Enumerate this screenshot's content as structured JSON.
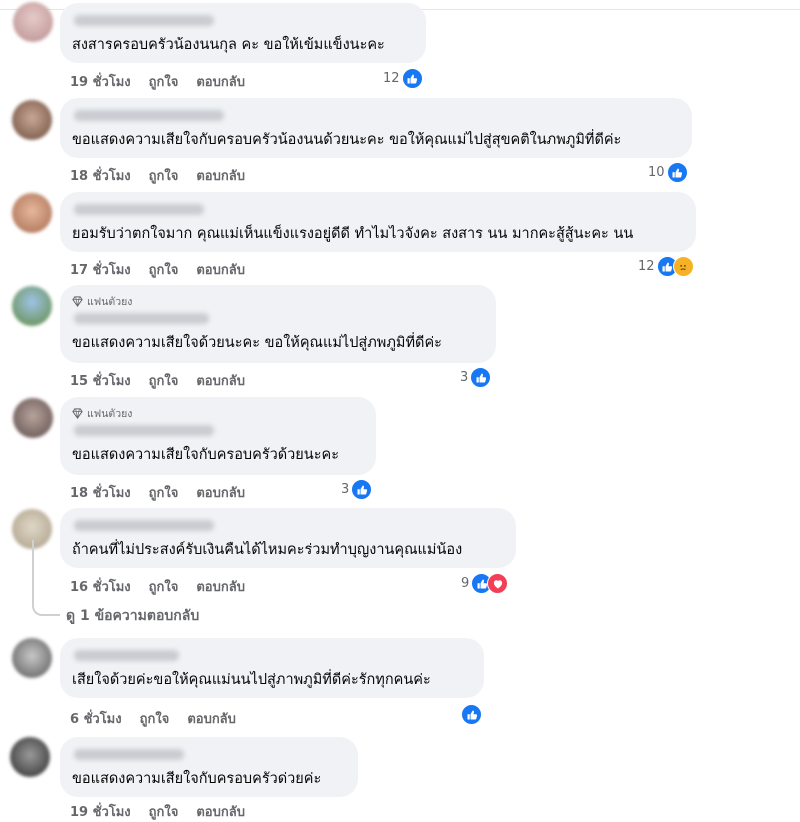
{
  "comments": [
    {
      "text": "สงสารครอบครัวน้องนนกุล คะ ขอให้เข้มแข็งนะคะ",
      "time": "19 ชั่วโมง",
      "like": "ถูกใจ",
      "reply": "ตอบกลับ",
      "count": "12",
      "badge": ""
    },
    {
      "text": "ขอแสดงความเสียใจกับครอบครัวน้องนนด้วยนะคะ ขอให้คุณแม่ไปสู่สุขคติในภพภูมิที่ดีค่ะ",
      "time": "18 ชั่วโมง",
      "like": "ถูกใจ",
      "reply": "ตอบกลับ",
      "count": "10",
      "badge": ""
    },
    {
      "text": "ยอมรับว่าตกใจมาก คุณแม่เห็นแข็งแรงอยู่ดีดี ทำไมไวจังคะ สงสาร นน มากคะสู้สู้นะคะ นน",
      "time": "17 ชั่วโมง",
      "like": "ถูกใจ",
      "reply": "ตอบกลับ",
      "count": "12",
      "badge": ""
    },
    {
      "text": "ขอแสดงความเสียใจด้วยนะคะ ขอให้คุณแม่ไปสู่ภพภูมิที่ดีค่ะ",
      "time": "15 ชั่วโมง",
      "like": "ถูกใจ",
      "reply": "ตอบกลับ",
      "count": "3",
      "badge": "แฟนตัวยง"
    },
    {
      "text": "ขอแสดงความเสียใจกับครอบครัวด้วยนะคะ",
      "time": "18 ชั่วโมง",
      "like": "ถูกใจ",
      "reply": "ตอบกลับ",
      "count": "3",
      "badge": "แฟนตัวยง"
    },
    {
      "text": "ถ้าคนที่ไม่ประสงค์รับเงินคืนได้ไหมคะร่วมทำบุญงานคุณแม่น้อง",
      "time": "16 ชั่วโมง",
      "like": "ถูกใจ",
      "reply": "ตอบกลับ",
      "count": "9",
      "badge": ""
    },
    {
      "text": "เสียใจด้วยค่ะขอให้คุณแม่นนไปสู่ภาพภูมิที่ดีค่ะรักทุกคนค่ะ",
      "time": "6 ชั่วโมง",
      "like": "ถูกใจ",
      "reply": "ตอบกลับ",
      "count": "",
      "badge": ""
    },
    {
      "text": "ขอแสดงความเสียใจกับครอบครัวด่วยค่ะ",
      "time": "19 ชั่วโมง",
      "like": "ถูกใจ",
      "reply": "ตอบกลับ",
      "count": "",
      "badge": ""
    }
  ],
  "view_replies": "ดู 1 ข้อความตอบกลับ",
  "colors": {
    "like": "#1877f2",
    "love": "#f33e58",
    "sad": "#f7b125",
    "bubble": "#f0f2f5",
    "meta": "#65676b"
  },
  "icons": {
    "like": "thumbs-up-icon",
    "love": "heart-icon",
    "sad": "sad-face-icon",
    "badge": "diamond-icon"
  }
}
